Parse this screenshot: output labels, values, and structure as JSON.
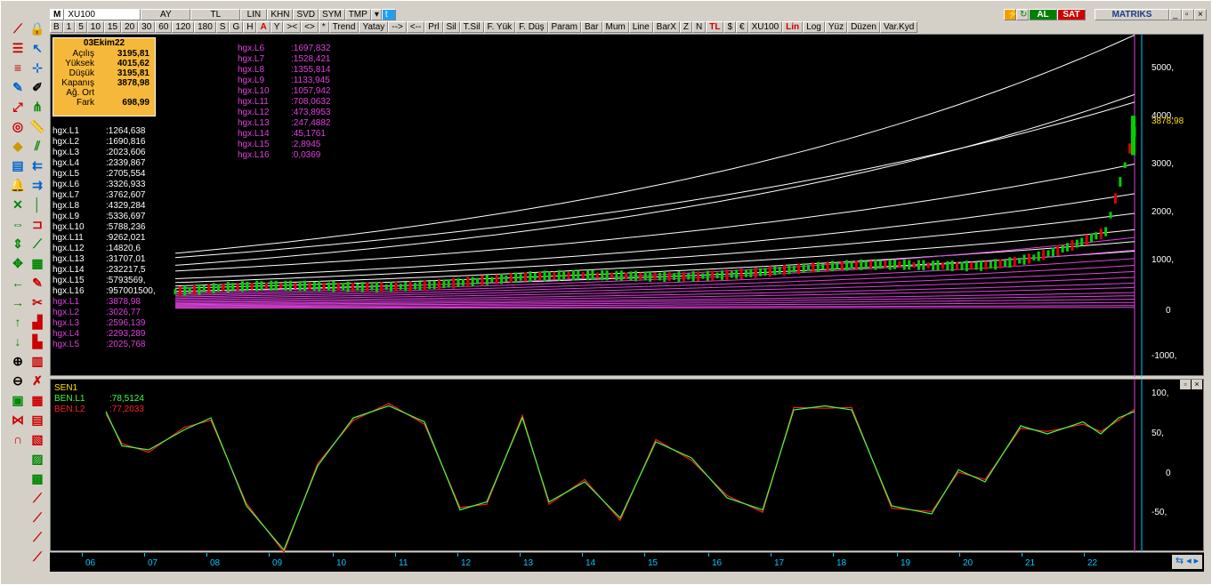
{
  "toolbar1": {
    "m": "M",
    "symbol": "XU100",
    "period": "AY",
    "currency": "TL",
    "scale": "LIN",
    "khn": "KHN",
    "svd": "SVD",
    "sym": "SYM",
    "tmp": "TMP",
    "al": "AL",
    "sat": "SAT",
    "brand": "MATRIKS"
  },
  "toolbar2": [
    "B",
    "1",
    "5",
    "10",
    "15",
    "20",
    "30",
    "60",
    "120",
    "180",
    "S",
    "G",
    "H",
    "A",
    "Y",
    "><",
    "<>",
    "*",
    "Trend",
    "Yatay",
    "-->",
    "<--",
    "Prl",
    "Sil",
    "T.Sil",
    "F. Yük",
    "F. Düş",
    "Param",
    "Bar",
    "Mum",
    "Line",
    "BarX",
    "Z",
    "N",
    "TL",
    "$",
    "€",
    "XU100",
    "Lin",
    "Log",
    "Yüz",
    "Düzen",
    "Var.Kyd"
  ],
  "ohlc": {
    "date": "03Ekim22",
    "rows": [
      {
        "k": "Açılış",
        "v": "3195,81"
      },
      {
        "k": "Yüksek",
        "v": "4015,62"
      },
      {
        "k": "Düşük",
        "v": "3195,81"
      },
      {
        "k": "Kapanış",
        "v": "3878,98"
      },
      {
        "k": "Ağ. Ort",
        "v": ""
      },
      {
        "k": "Fark",
        "v": "698,99"
      }
    ]
  },
  "levels_white": [
    {
      "k": "hgx.L1",
      "v": ":1264,638"
    },
    {
      "k": "hgx.L2",
      "v": ":1690,816"
    },
    {
      "k": "hgx.L3",
      "v": ":2023,606"
    },
    {
      "k": "hgx.L4",
      "v": ":2339,867"
    },
    {
      "k": "hgx.L5",
      "v": ":2705,554"
    },
    {
      "k": "hgx.L6",
      "v": ":3326,933"
    },
    {
      "k": "hgx.L7",
      "v": ":3762,607"
    },
    {
      "k": "hgx.L8",
      "v": ":4329,284"
    },
    {
      "k": "hgx.L9",
      "v": ":5336,697"
    },
    {
      "k": "hgx.L10",
      "v": ":5788,236"
    },
    {
      "k": "hgx.L11",
      "v": ":9262,021"
    },
    {
      "k": "hgx.L12",
      "v": ":14820,6"
    },
    {
      "k": "hgx.L13",
      "v": ":31707,01"
    },
    {
      "k": "hgx.L14",
      "v": ":232217,5"
    },
    {
      "k": "hgx.L15",
      "v": ":5793569,"
    },
    {
      "k": "hgx.L16",
      "v": ":957001500,"
    }
  ],
  "levels_magenta_a": [
    {
      "k": "hgx.L1",
      "v": ":3878,98"
    },
    {
      "k": "hgx.L2",
      "v": ":3026,77"
    },
    {
      "k": "hgx.L3",
      "v": ":2596,139"
    },
    {
      "k": "hgx.L4",
      "v": ":2293,289"
    },
    {
      "k": "hgx.L5",
      "v": ":2025,768"
    }
  ],
  "levels_magenta_b": [
    {
      "k": "hgx.L6",
      "v": ":1697,832"
    },
    {
      "k": "hgx.L7",
      "v": ":1528,421"
    },
    {
      "k": "hgx.L8",
      "v": ":1355,814"
    },
    {
      "k": "hgx.L9",
      "v": ":1133,945"
    },
    {
      "k": "hgx.L10",
      "v": ":1057,942"
    },
    {
      "k": "hgx.L11",
      "v": ":708,0632"
    },
    {
      "k": "hgx.L12",
      "v": ":473,8953"
    },
    {
      "k": "hgx.L13",
      "v": ":247,4882"
    },
    {
      "k": "hgx.L14",
      "v": ":45,1761"
    },
    {
      "k": "hgx.L15",
      "v": ":2,8945"
    },
    {
      "k": "hgx.L16",
      "v": ":0,0369"
    }
  ],
  "price_axis": [
    "5000,",
    "4000,",
    "3000,",
    "2000,",
    "1000,",
    "0",
    "-1000,"
  ],
  "last_price": "3878,98",
  "osc": {
    "title": "SEN1",
    "l1": {
      "k": "BEN.L1",
      "v": ":78,5124"
    },
    "l2": {
      "k": "BEN.L2",
      "v": ":77,2033"
    },
    "axis": [
      "100,",
      "50,",
      "0",
      "-50,"
    ]
  },
  "time_axis": [
    "06",
    "07",
    "08",
    "09",
    "10",
    "11",
    "12",
    "13",
    "14",
    "15",
    "16",
    "17",
    "18",
    "19",
    "20",
    "21",
    "22"
  ],
  "colors": {
    "bg": "#000000",
    "white_curve": "#ffffff",
    "magenta_curve": "#e040e0",
    "up": "#00d000",
    "down": "#e00000",
    "label_white": "#ffffff",
    "label_magenta": "#e040e0",
    "osc_green": "#40ff40",
    "osc_red": "#ff2020"
  },
  "icons": [
    "drawing-tools",
    "arrow-tools",
    "fibonacci-tools",
    "zoom-tools",
    "gann-tools"
  ]
}
